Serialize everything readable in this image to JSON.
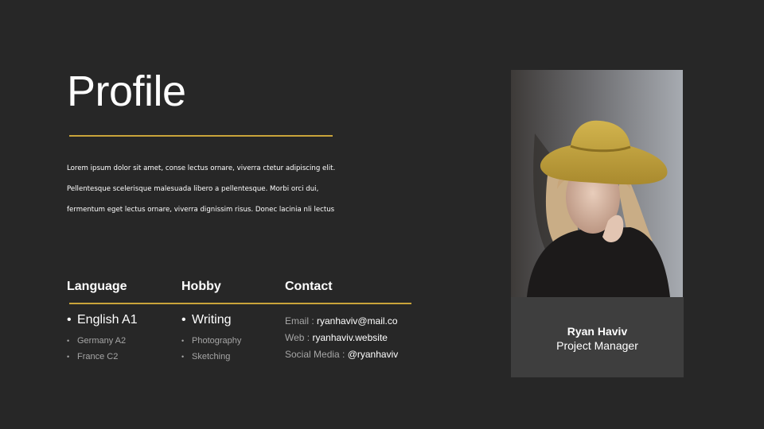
{
  "page": {
    "title": "Profile",
    "accent_color": "#c9a43a",
    "background_color": "#272727"
  },
  "intro": {
    "lines": [
      "Lorem ipsum dolor sit amet, conse lectus ornare, viverra ctetur adipiscing elit.",
      "Pellentesque scelerisque malesuada libero a pellentesque. Morbi orci dui,",
      "fermentum eget lectus ornare, viverra dignissim risus. Donec lacinia nli lectus"
    ]
  },
  "language": {
    "heading": "Language",
    "primary": "English A1",
    "others": [
      "Germany A2",
      "France C2"
    ]
  },
  "hobby": {
    "heading": "Hobby",
    "primary": "Writing",
    "others": [
      "Photography",
      "Sketching"
    ]
  },
  "contact": {
    "heading": "Contact",
    "items": [
      {
        "label": "Email : ",
        "value": "ryanhaviv@mail.co"
      },
      {
        "label": "Web : ",
        "value": "ryanhaviv.website"
      },
      {
        "label": "Social Media : ",
        "value": "@ryanhaviv"
      }
    ]
  },
  "person": {
    "name": "Ryan Haviv",
    "role": "Project Manager",
    "photo_icon": "portrait-photo-icon"
  }
}
